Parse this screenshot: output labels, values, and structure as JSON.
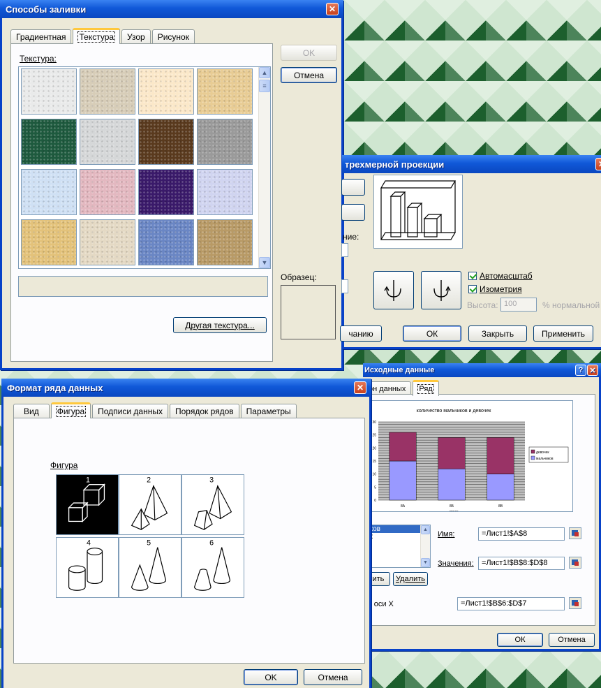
{
  "fill_dialog": {
    "title": "Способы заливки",
    "tabs": [
      "Градиентная",
      "Текстура",
      "Узор",
      "Рисунок"
    ],
    "texture_label": "Текстура:",
    "ok": "OK",
    "cancel": "Отмена",
    "sample_label": "Образец:",
    "other_texture": "Другая текстура...",
    "swatch_colors": [
      "#e9eaea",
      "#d7cdb8",
      "#fbe8c9",
      "#e8cc94",
      "#1e5a3e",
      "#d5d7d8",
      "#5a3a1e",
      "#9a9a9a",
      "#cfe0f4",
      "#e3b8c0",
      "#3a1a6a",
      "#d0d4f0",
      "#e3c27a",
      "#e4d9c4",
      "#6a86c4",
      "#b89a66"
    ]
  },
  "view3d_dialog": {
    "title": "трехмерной проекции",
    "partial_label": "ние:",
    "autoscale": "Автомасштаб",
    "isometry": "Изометрия",
    "height_label": "Высота:",
    "height_value": "100",
    "height_unit": "% нормальной",
    "default_btn": "чанию",
    "ok": "ОК",
    "close": "Закрыть",
    "apply": "Применить"
  },
  "format_dialog": {
    "title": "Формат ряда данных",
    "tabs": [
      "Вид",
      "Фигура",
      "Подписи данных",
      "Порядок рядов",
      "Параметры"
    ],
    "shape_label": "Фигура",
    "shape_numbers": [
      "1",
      "2",
      "3",
      "4",
      "5",
      "6"
    ],
    "ok": "OK",
    "cancel": "Отмена"
  },
  "source_dialog": {
    "title": "Исходные данные",
    "tabs": [
      "он данных",
      "Ряд"
    ],
    "series_items": [
      "иков",
      "ек"
    ],
    "name_label": "Имя:",
    "name_value": "=Лист1!$A$8",
    "values_label": "Значения:",
    "values_value": "=Лист1!$B$8:$D$8",
    "add_btn": "вить",
    "delete_btn": "Удалить",
    "xaxis_label": "си оси X",
    "xaxis_value": "=Лист1!$B$6:$D$7",
    "ok": "ОК",
    "cancel": "Отмена"
  },
  "chart_data": {
    "type": "bar",
    "stacked": true,
    "title": "количество мальчиков и девочек",
    "xlabel": "класс",
    "ylabel": "количество",
    "categories": [
      "8А",
      "8Б",
      "8В"
    ],
    "yticks": [
      "0",
      "5",
      "10",
      "15",
      "20",
      "25",
      "30"
    ],
    "ylim": [
      0,
      30
    ],
    "series": [
      {
        "name": "мальчиков",
        "values": [
          15,
          12,
          10
        ],
        "color": "#9999ff"
      },
      {
        "name": "девочек",
        "values": [
          11,
          12,
          14
        ],
        "color": "#993366"
      }
    ],
    "legend_position": "right"
  }
}
